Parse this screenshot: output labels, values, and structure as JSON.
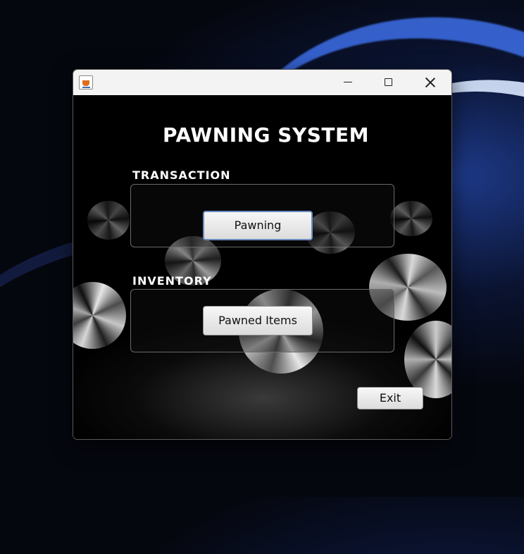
{
  "window": {
    "app_icon": "java-cup-icon",
    "controls": {
      "minimize_icon": "minimize-icon",
      "maximize_icon": "maximize-icon",
      "close_icon": "close-icon"
    }
  },
  "main": {
    "title": "PAWNING SYSTEM",
    "transaction": {
      "label": "TRANSACTION",
      "button_label": "Pawning"
    },
    "inventory": {
      "label": "INVENTORY",
      "button_label": "Pawned Items"
    },
    "exit_label": "Exit"
  },
  "colors": {
    "title_text": "#ffffff",
    "button_focus_border": "#6a8cc0",
    "titlebar_bg": "#f3f3f3",
    "content_bg": "#000000"
  }
}
